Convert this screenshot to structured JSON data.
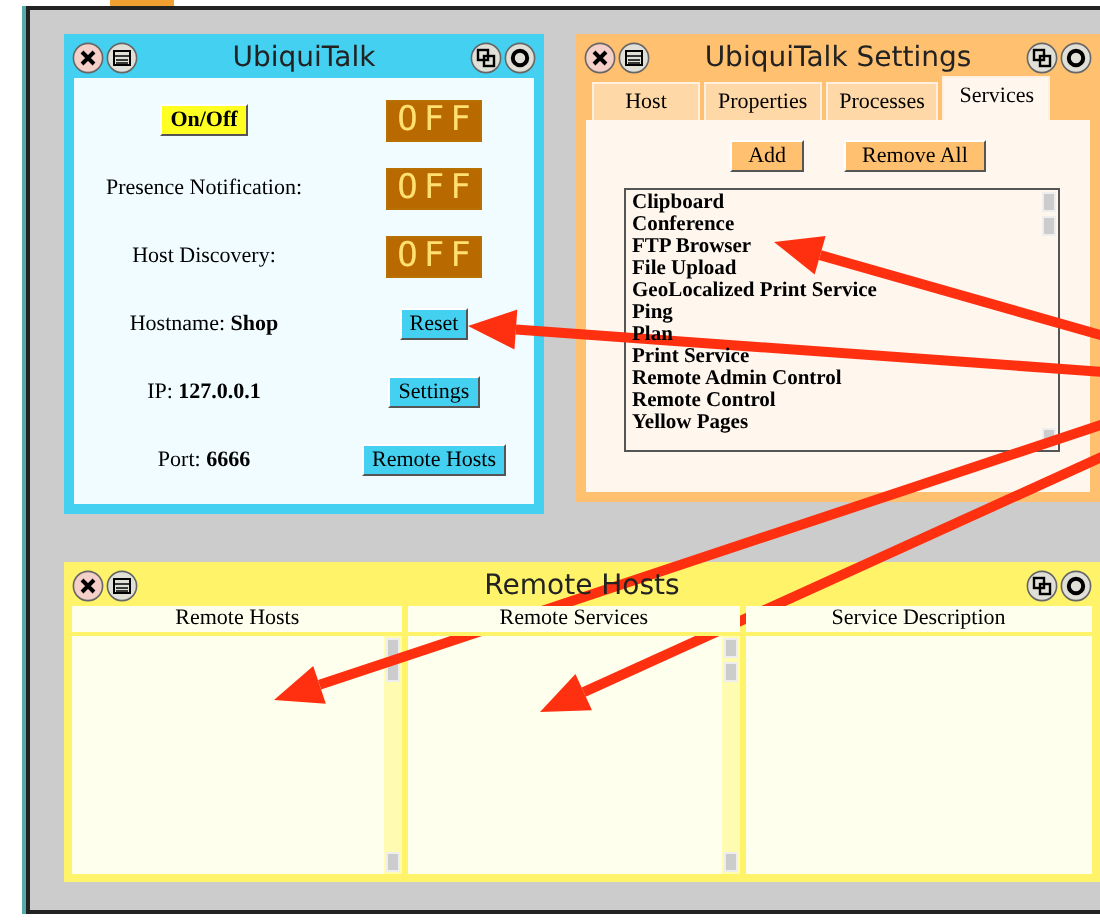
{
  "main_window": {
    "title": "UbiquiTalk",
    "rows": [
      {
        "kind": "toggle",
        "button": "On/Off",
        "display": "OFF"
      },
      {
        "kind": "status",
        "label": "Presence Notification:",
        "display": "OFF"
      },
      {
        "kind": "status",
        "label": "Host Discovery:",
        "display": "OFF"
      },
      {
        "kind": "action",
        "label": "Hostname: **Shop**",
        "button": "Reset"
      },
      {
        "kind": "action",
        "label": "IP: **127.0.0.1**",
        "button": "Settings"
      },
      {
        "kind": "action",
        "label": "Port: **6666**",
        "button": "Remote Hosts"
      }
    ]
  },
  "settings_window": {
    "title": "UbiquiTalk Settings",
    "tabs": [
      {
        "label": "Host",
        "selected": false
      },
      {
        "label": "Properties",
        "selected": false
      },
      {
        "label": "Processes",
        "selected": false
      },
      {
        "label": "Services",
        "selected": true
      }
    ],
    "buttons": [
      "Add",
      "Remove All"
    ],
    "services": [
      "Clipboard",
      "Conference",
      "FTP Browser",
      "File Upload",
      "GeoLocalized Print Service",
      "Ping",
      "Plan",
      "Print Service",
      "Remote Admin Control",
      "Remote Control",
      "Yellow Pages"
    ]
  },
  "remote_window": {
    "title": "Remote Hosts",
    "columns": [
      {
        "heading": "Remote Hosts",
        "scrollbar": true
      },
      {
        "heading": "Remote Services",
        "scrollbar": true
      },
      {
        "heading": "Service Description",
        "scrollbar": false
      }
    ]
  }
}
